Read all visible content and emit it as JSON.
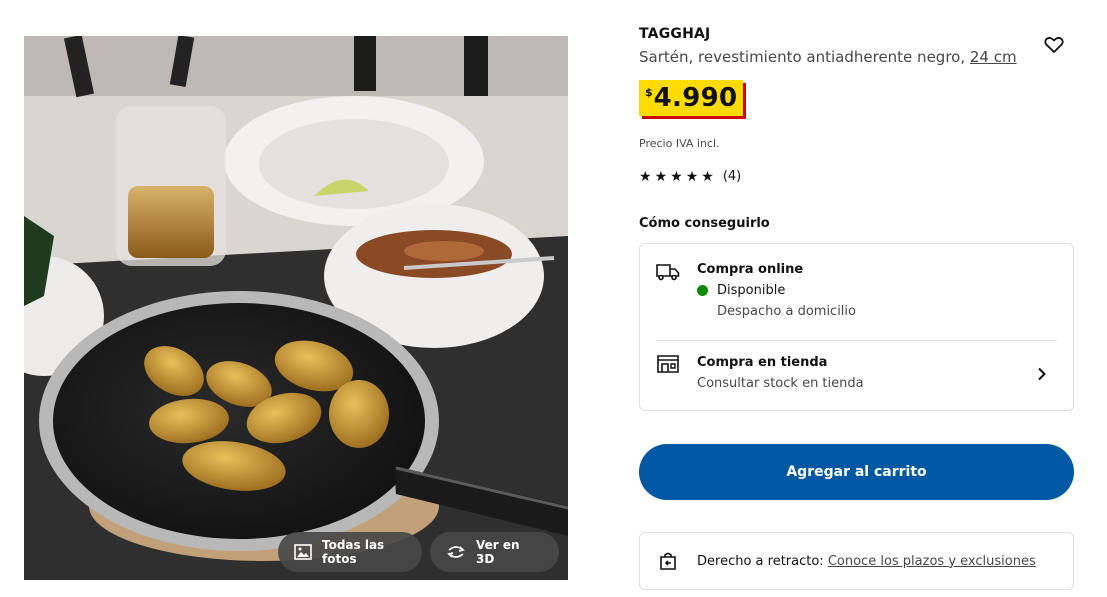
{
  "product": {
    "name": "TAGGHAJ",
    "description": "Sartén, revestimiento antiadherente negro,",
    "size_link": "24 cm",
    "price": {
      "currency": "$",
      "amount": "4.990"
    },
    "vat_note": "Precio IVA incl.",
    "rating": {
      "stars": 5,
      "count": "(4)"
    }
  },
  "media": {
    "all_photos_label": "Todas las fotos",
    "view_3d_label": "Ver en 3D"
  },
  "availability": {
    "heading": "Cómo conseguirlo",
    "online": {
      "title": "Compra online",
      "status": "Disponible",
      "status_color": "#0a8a00",
      "sub": "Despacho a domicilio",
      "icon": "truck-icon"
    },
    "store": {
      "title": "Compra en tienda",
      "sub": "Consultar stock en tienda",
      "icon": "store-icon"
    }
  },
  "cart": {
    "label": "Agregar al carrito",
    "color": "#0058a3"
  },
  "returns": {
    "label": "Derecho a retracto:",
    "link": "Conoce los plazos y exclusiones",
    "icon": "return-bag-icon"
  },
  "colors": {
    "price_bg": "#ffdb00",
    "price_shadow": "#cc0008"
  }
}
